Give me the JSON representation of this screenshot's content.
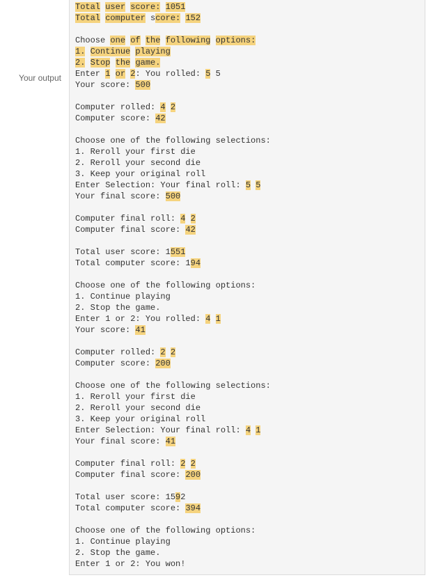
{
  "label": "Your output",
  "highlight_color": "#f5d37e",
  "lines": [
    [
      {
        "t": "Total",
        "hl": true
      },
      {
        "t": " "
      },
      {
        "t": "user",
        "hl": true
      },
      {
        "t": " "
      },
      {
        "t": "score:",
        "hl": true
      },
      {
        "t": " "
      },
      {
        "t": "1051",
        "hl": true
      }
    ],
    [
      {
        "t": "Total",
        "hl": true
      },
      {
        "t": " "
      },
      {
        "t": "computer",
        "hl": true
      },
      {
        "t": " s"
      },
      {
        "t": "core:",
        "hl": true
      },
      {
        "t": " "
      },
      {
        "t": "152",
        "hl": true
      }
    ],
    [],
    [
      {
        "t": "Choose "
      },
      {
        "t": "one",
        "hl": true
      },
      {
        "t": " "
      },
      {
        "t": "of",
        "hl": true
      },
      {
        "t": " "
      },
      {
        "t": "the",
        "hl": true
      },
      {
        "t": " "
      },
      {
        "t": "following",
        "hl": true
      },
      {
        "t": " "
      },
      {
        "t": "options:",
        "hl": true
      }
    ],
    [
      {
        "t": "1.",
        "hl": true
      },
      {
        "t": " "
      },
      {
        "t": "Continue",
        "hl": true
      },
      {
        "t": " "
      },
      {
        "t": "playing",
        "hl": true
      }
    ],
    [
      {
        "t": "2.",
        "hl": true
      },
      {
        "t": " "
      },
      {
        "t": "Stop",
        "hl": true
      },
      {
        "t": " "
      },
      {
        "t": "the",
        "hl": true
      },
      {
        "t": " "
      },
      {
        "t": "game.",
        "hl": true
      }
    ],
    [
      {
        "t": "Enter "
      },
      {
        "t": "1",
        "hl": true
      },
      {
        "t": " "
      },
      {
        "t": "or",
        "hl": true
      },
      {
        "t": " "
      },
      {
        "t": "2",
        "hl": true
      },
      {
        "t": ": You rolled: "
      },
      {
        "t": "5",
        "hl": true
      },
      {
        "t": " 5"
      }
    ],
    [
      {
        "t": "Your score: "
      },
      {
        "t": "500",
        "hl": true
      }
    ],
    [],
    [
      {
        "t": "Computer rolled: "
      },
      {
        "t": "4",
        "hl": true
      },
      {
        "t": " "
      },
      {
        "t": "2",
        "hl": true
      }
    ],
    [
      {
        "t": "Computer score: "
      },
      {
        "t": "42",
        "hl": true
      }
    ],
    [],
    [
      {
        "t": "Choose one of the following selections:"
      }
    ],
    [
      {
        "t": "1. Reroll your first die"
      }
    ],
    [
      {
        "t": "2. Reroll your second die"
      }
    ],
    [
      {
        "t": "3. Keep your original roll"
      }
    ],
    [
      {
        "t": "Enter Selection: Your final roll: "
      },
      {
        "t": "5",
        "hl": true
      },
      {
        "t": " "
      },
      {
        "t": "5",
        "hl": true
      }
    ],
    [
      {
        "t": "Your final score: "
      },
      {
        "t": "500",
        "hl": true
      }
    ],
    [],
    [
      {
        "t": "Computer final roll: "
      },
      {
        "t": "4",
        "hl": true
      },
      {
        "t": " "
      },
      {
        "t": "2",
        "hl": true
      }
    ],
    [
      {
        "t": "Computer final score: "
      },
      {
        "t": "42",
        "hl": true
      }
    ],
    [],
    [
      {
        "t": "Total user score: 1"
      },
      {
        "t": "551",
        "hl": true
      }
    ],
    [
      {
        "t": "Total computer score: 1"
      },
      {
        "t": "94",
        "hl": true
      }
    ],
    [],
    [
      {
        "t": "Choose one of the following options:"
      }
    ],
    [
      {
        "t": "1. Continue playing"
      }
    ],
    [
      {
        "t": "2. Stop the game."
      }
    ],
    [
      {
        "t": "Enter 1 or 2: You rolled: "
      },
      {
        "t": "4",
        "hl": true
      },
      {
        "t": " "
      },
      {
        "t": "1",
        "hl": true
      }
    ],
    [
      {
        "t": "Your score: "
      },
      {
        "t": "41",
        "hl": true
      }
    ],
    [],
    [
      {
        "t": "Computer rolled: "
      },
      {
        "t": "2",
        "hl": true
      },
      {
        "t": " "
      },
      {
        "t": "2",
        "hl": true
      }
    ],
    [
      {
        "t": "Computer score: "
      },
      {
        "t": "200",
        "hl": true
      }
    ],
    [],
    [
      {
        "t": "Choose one of the following selections:"
      }
    ],
    [
      {
        "t": "1. Reroll your first die"
      }
    ],
    [
      {
        "t": "2. Reroll your second die"
      }
    ],
    [
      {
        "t": "3. Keep your original roll"
      }
    ],
    [
      {
        "t": "Enter Selection: Your final roll: "
      },
      {
        "t": "4",
        "hl": true
      },
      {
        "t": " "
      },
      {
        "t": "1",
        "hl": true
      }
    ],
    [
      {
        "t": "Your final score: "
      },
      {
        "t": "41",
        "hl": true
      }
    ],
    [],
    [
      {
        "t": "Computer final roll: "
      },
      {
        "t": "2",
        "hl": true
      },
      {
        "t": " "
      },
      {
        "t": "2",
        "hl": true
      }
    ],
    [
      {
        "t": "Computer final score: "
      },
      {
        "t": "200",
        "hl": true
      }
    ],
    [],
    [
      {
        "t": "Total user score: 15"
      },
      {
        "t": "9",
        "hl": true
      },
      {
        "t": "2"
      }
    ],
    [
      {
        "t": "Total computer score: "
      },
      {
        "t": "394",
        "hl": true
      }
    ],
    [],
    [
      {
        "t": "Choose one of the following options:"
      }
    ],
    [
      {
        "t": "1. Continue playing"
      }
    ],
    [
      {
        "t": "2. Stop the game."
      }
    ],
    [
      {
        "t": "Enter 1 or 2: You won!"
      }
    ]
  ]
}
